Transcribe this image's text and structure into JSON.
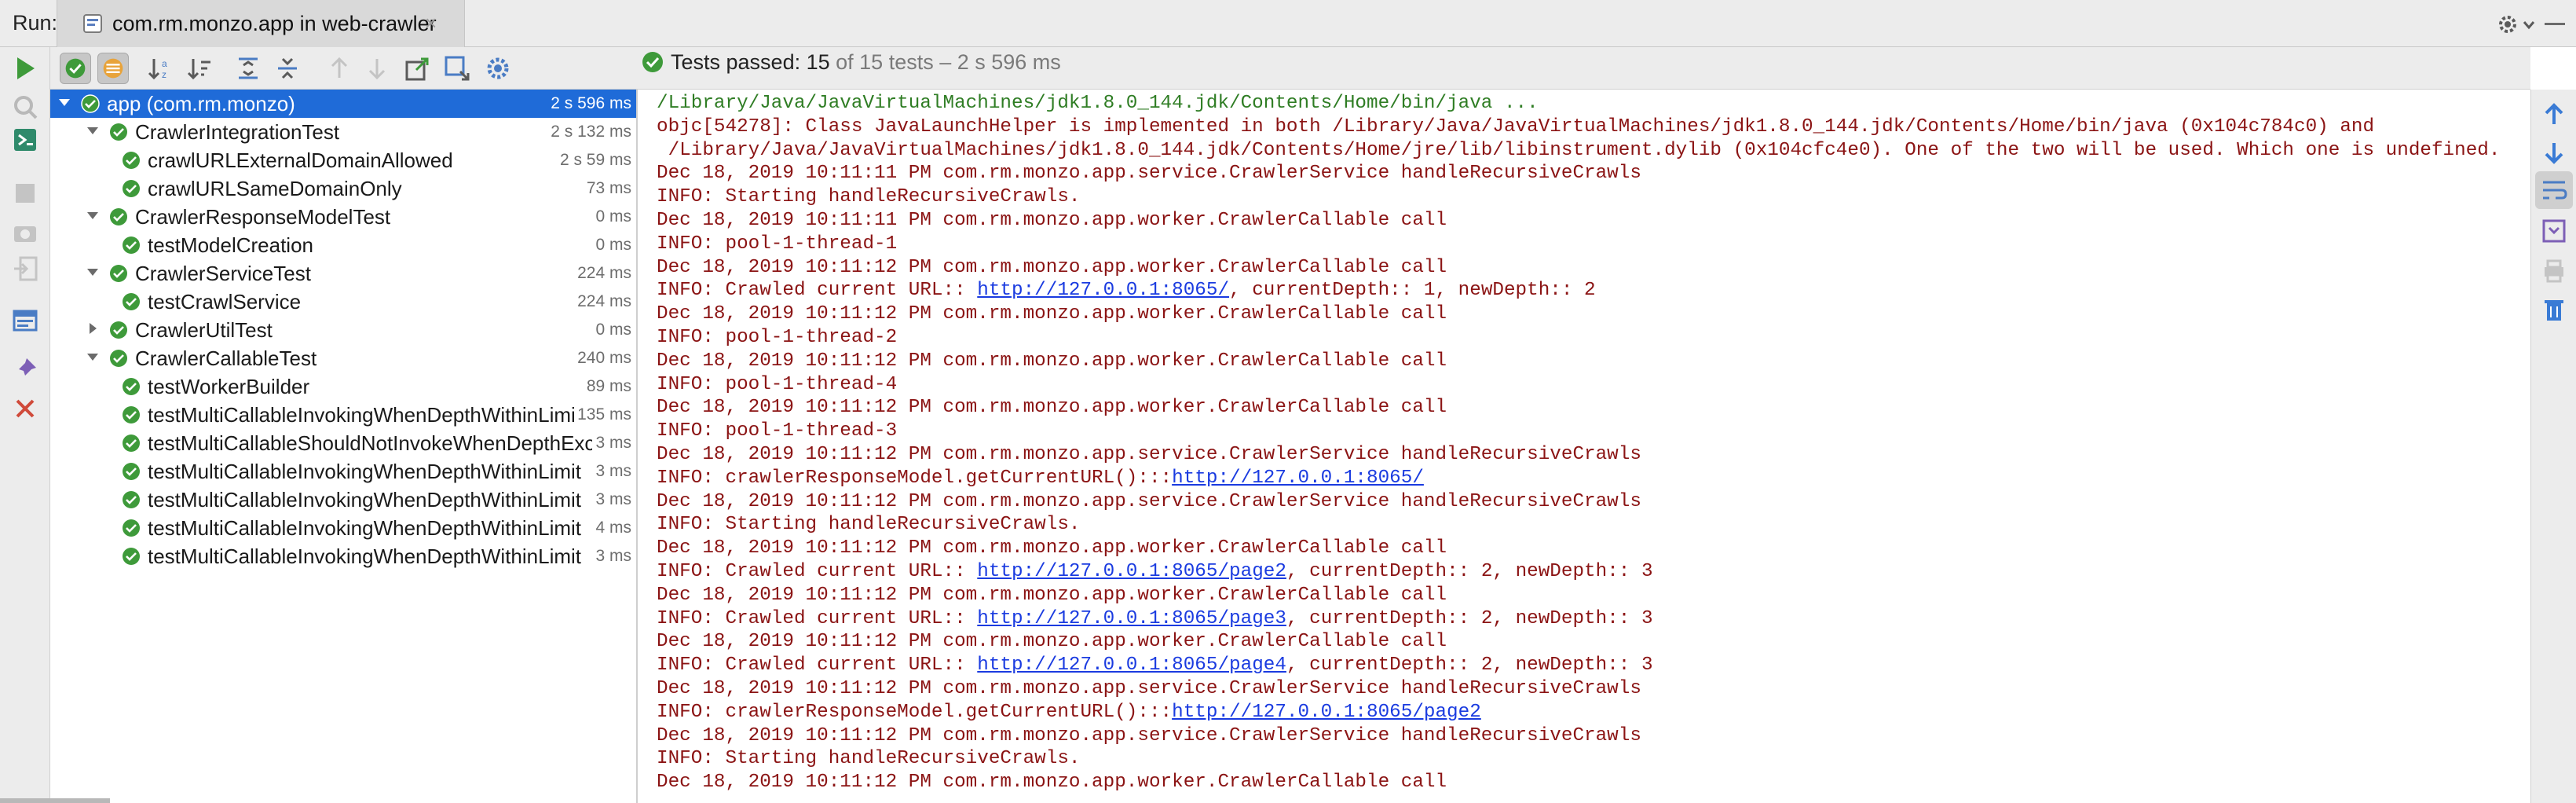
{
  "header": {
    "run_label": "Run:",
    "tab_title": "com.rm.monzo.app in web-crawler",
    "tab_close": "×"
  },
  "status": {
    "passed_prefix": "Tests passed: ",
    "passed_count": "15",
    "rest": " of 15 tests – 2 s 596 ms"
  },
  "tree": [
    {
      "name": "app (com.rm.monzo)",
      "time": "2 s 596 ms",
      "level": 0,
      "expanded": true,
      "selected": true
    },
    {
      "name": "CrawlerIntegrationTest",
      "time": "2 s 132 ms",
      "level": 1,
      "expanded": true
    },
    {
      "name": "crawlURLExternalDomainAllowed",
      "time": "2 s 59 ms",
      "level": 2
    },
    {
      "name": "crawlURLSameDomainOnly",
      "time": "73 ms",
      "level": 2
    },
    {
      "name": "CrawlerResponseModelTest",
      "time": "0 ms",
      "level": 1,
      "expanded": true
    },
    {
      "name": "testModelCreation",
      "time": "0 ms",
      "level": 2
    },
    {
      "name": "CrawlerServiceTest",
      "time": "224 ms",
      "level": 1,
      "expanded": true
    },
    {
      "name": "testCrawlService",
      "time": "224 ms",
      "level": 2
    },
    {
      "name": "CrawlerUtilTest",
      "time": "0 ms",
      "level": 1,
      "expanded": false
    },
    {
      "name": "CrawlerCallableTest",
      "time": "240 ms",
      "level": 1,
      "expanded": true
    },
    {
      "name": "testWorkerBuilder",
      "time": "89 ms",
      "level": 2
    },
    {
      "name": "testMultiCallableInvokingWhenDepthWithinLimit",
      "time": "135 ms",
      "level": 2
    },
    {
      "name": "testMultiCallableShouldNotInvokeWhenDepthExceeded",
      "time": "3 ms",
      "level": 2
    },
    {
      "name": "testMultiCallableInvokingWhenDepthWithinLimit",
      "time": "3 ms",
      "level": 2
    },
    {
      "name": "testMultiCallableInvokingWhenDepthWithinLimit",
      "time": "3 ms",
      "level": 2
    },
    {
      "name": "testMultiCallableInvokingWhenDepthWithinLimit",
      "time": "4 ms",
      "level": 2
    },
    {
      "name": "testMultiCallableInvokingWhenDepthWithinLimit",
      "time": "3 ms",
      "level": 2
    }
  ],
  "console": [
    {
      "text": "/Library/Java/JavaVirtualMachines/jdk1.8.0_144.jdk/Contents/Home/bin/java ...",
      "kind": "cmd"
    },
    {
      "text": "objc[54278]: Class JavaLaunchHelper is implemented in both /Library/Java/JavaVirtualMachines/jdk1.8.0_144.jdk/Contents/Home/bin/java (0x104c784c0) and"
    },
    {
      "text": " /Library/Java/JavaVirtualMachines/jdk1.8.0_144.jdk/Contents/Home/jre/lib/libinstrument.dylib (0x104cfc4e0). One of the two will be used. Which one is undefined."
    },
    {
      "text": "Dec 18, 2019 10:11:11 PM com.rm.monzo.app.service.CrawlerService handleRecursiveCrawls"
    },
    {
      "text": "INFO: Starting handleRecursiveCrawls."
    },
    {
      "text": "Dec 18, 2019 10:11:11 PM com.rm.monzo.app.worker.CrawlerCallable call"
    },
    {
      "text": "INFO: pool-1-thread-1"
    },
    {
      "text": "Dec 18, 2019 10:11:12 PM com.rm.monzo.app.worker.CrawlerCallable call"
    },
    {
      "text": "INFO: Crawled current URL:: ",
      "link": "http://127.0.0.1:8065/",
      "after": ", currentDepth:: 1, newDepth:: 2"
    },
    {
      "text": "Dec 18, 2019 10:11:12 PM com.rm.monzo.app.worker.CrawlerCallable call"
    },
    {
      "text": "INFO: pool-1-thread-2"
    },
    {
      "text": "Dec 18, 2019 10:11:12 PM com.rm.monzo.app.worker.CrawlerCallable call"
    },
    {
      "text": "INFO: pool-1-thread-4"
    },
    {
      "text": "Dec 18, 2019 10:11:12 PM com.rm.monzo.app.worker.CrawlerCallable call"
    },
    {
      "text": "INFO: pool-1-thread-3"
    },
    {
      "text": "Dec 18, 2019 10:11:12 PM com.rm.monzo.app.service.CrawlerService handleRecursiveCrawls"
    },
    {
      "text": "INFO: crawlerResponseModel.getCurrentURL():::",
      "link": "http://127.0.0.1:8065/",
      "after": ""
    },
    {
      "text": "Dec 18, 2019 10:11:12 PM com.rm.monzo.app.service.CrawlerService handleRecursiveCrawls"
    },
    {
      "text": "INFO: Starting handleRecursiveCrawls."
    },
    {
      "text": "Dec 18, 2019 10:11:12 PM com.rm.monzo.app.worker.CrawlerCallable call"
    },
    {
      "text": "INFO: Crawled current URL:: ",
      "link": "http://127.0.0.1:8065/page2",
      "after": ", currentDepth:: 2, newDepth:: 3"
    },
    {
      "text": "Dec 18, 2019 10:11:12 PM com.rm.monzo.app.worker.CrawlerCallable call"
    },
    {
      "text": "INFO: Crawled current URL:: ",
      "link": "http://127.0.0.1:8065/page3",
      "after": ", currentDepth:: 2, newDepth:: 3"
    },
    {
      "text": "Dec 18, 2019 10:11:12 PM com.rm.monzo.app.worker.CrawlerCallable call"
    },
    {
      "text": "INFO: Crawled current URL:: ",
      "link": "http://127.0.0.1:8065/page4",
      "after": ", currentDepth:: 2, newDepth:: 3"
    },
    {
      "text": "Dec 18, 2019 10:11:12 PM com.rm.monzo.app.service.CrawlerService handleRecursiveCrawls"
    },
    {
      "text": "INFO: crawlerResponseModel.getCurrentURL():::",
      "link": "http://127.0.0.1:8065/page2",
      "after": ""
    },
    {
      "text": "Dec 18, 2019 10:11:12 PM com.rm.monzo.app.service.CrawlerService handleRecursiveCrawls"
    },
    {
      "text": "INFO: Starting handleRecursiveCrawls."
    },
    {
      "text": "Dec 18, 2019 10:11:12 PM com.rm.monzo.app.worker.CrawlerCallable call"
    }
  ],
  "icons": {
    "left_toolbar": [
      "rerun-icon",
      "stop-icon",
      "debug-icon",
      "stop-square-icon",
      "camera-icon",
      "exit-icon",
      "layout-icon",
      "pin-icon",
      "close-icon"
    ],
    "toolbar": [
      "show-passed-icon",
      "show-ignored-icon",
      "sort-alpha-icon",
      "sort-duration-icon",
      "expand-all-icon",
      "collapse-all-icon",
      "prev-failed-icon",
      "next-failed-icon",
      "export-icon",
      "import-icon",
      "settings-icon"
    ],
    "right_toolbar": [
      "scroll-up-icon",
      "scroll-down-icon",
      "soft-wrap-icon",
      "scroll-to-end-icon",
      "print-icon",
      "trash-icon"
    ]
  },
  "colors": {
    "success": "#3e9a3a",
    "selection": "#1f6bd8",
    "console_text": "#8b1414",
    "console_cmd": "#2f7d24",
    "link": "#1a3be0"
  }
}
